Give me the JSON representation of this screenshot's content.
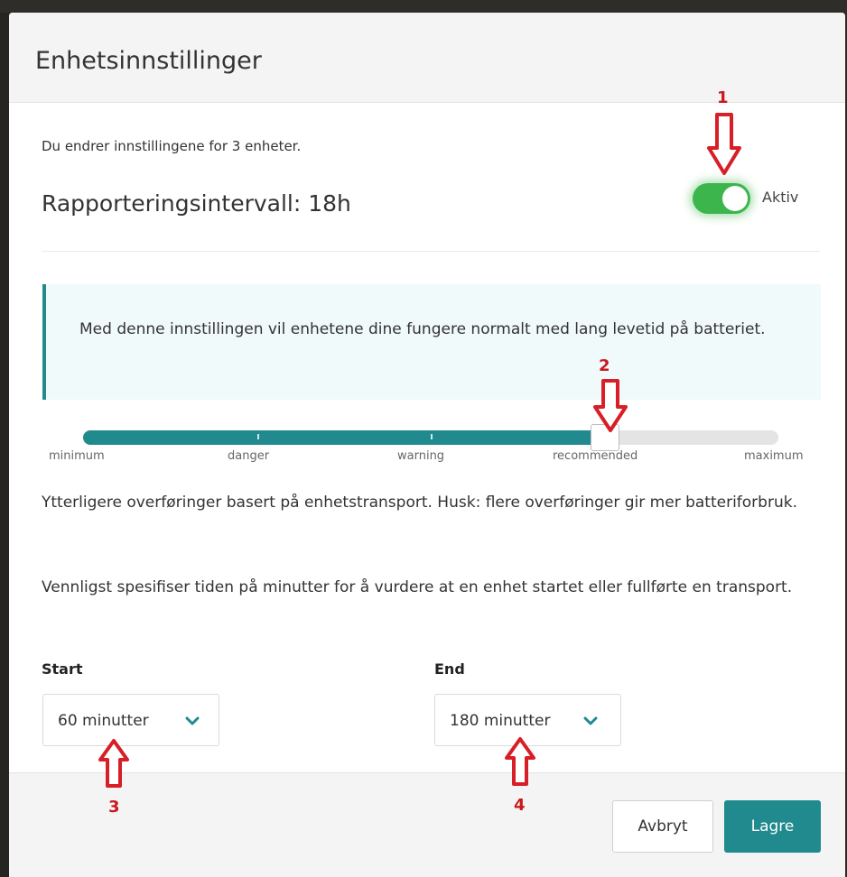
{
  "dialog": {
    "title": "Enhetsinnstillinger",
    "subtext": "Du endrer innstillingene for 3 enheter.",
    "interval_title": "Rapporteringsintervall: 18h",
    "toggle": {
      "label": "Aktiv",
      "on": true
    }
  },
  "info": {
    "text": "Med denne innstillingen vil enhetene dine fungere normalt med lang levetid på batteriet."
  },
  "slider": {
    "labels": [
      "minimum",
      "danger",
      "warning",
      "recommended",
      "maximum"
    ],
    "value_fraction": 0.75
  },
  "paragraphs": {
    "p1": "Ytterligere overføringer basert på enhetstransport. Husk: flere overføringer gir mer batteriforbruk.",
    "p2": "Vennligst spesifiser tiden på minutter for å vurdere at en enhet startet eller fullførte en transport."
  },
  "start": {
    "label": "Start",
    "value": "60 minutter"
  },
  "end": {
    "label": "End",
    "value": "180 minutter"
  },
  "footer": {
    "cancel": "Avbryt",
    "save": "Lagre"
  },
  "annotations": [
    "1",
    "2",
    "3",
    "4"
  ],
  "colors": {
    "accent": "#208a8e",
    "toggle": "#3cb64c",
    "annotation": "#c9191f"
  }
}
